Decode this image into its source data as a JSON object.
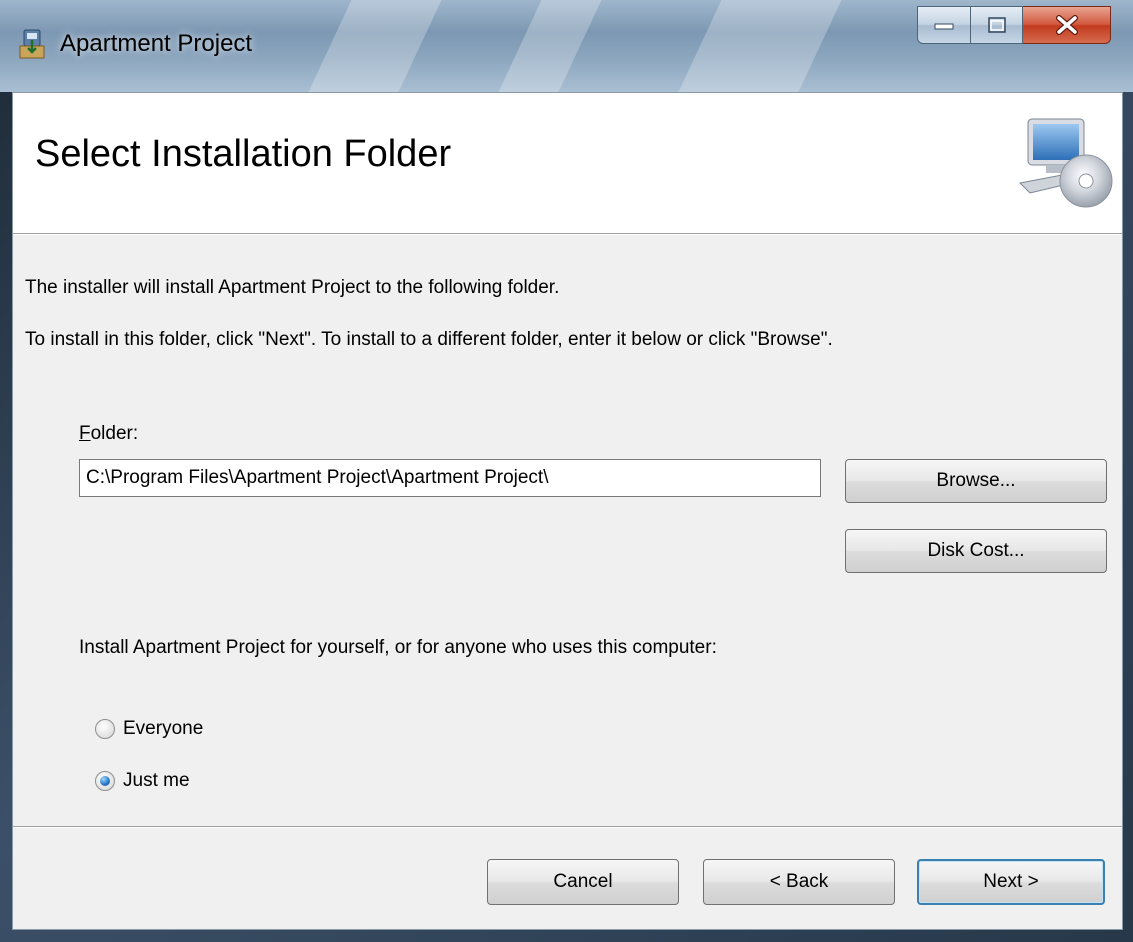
{
  "window": {
    "title": "Apartment Project",
    "caption_buttons": {
      "minimize": "minimize-icon",
      "maximize": "maximize-icon",
      "close": "close-icon"
    }
  },
  "banner": {
    "title": "Select Installation Folder",
    "icon": "computer-cd-icon"
  },
  "body": {
    "intro": "The installer will install Apartment Project to the following folder.",
    "instructions": "To install in this folder, click \"Next\". To install to a different folder, enter it below or click \"Browse\".",
    "folder_label_mnemonic": "F",
    "folder_label_rest": "older:",
    "folder_value": "C:\\Program Files\\Apartment Project\\Apartment Project\\",
    "browse_label": "Browse...",
    "disk_cost_label": "Disk Cost...",
    "scope_prompt": "Install Apartment Project for yourself, or for anyone who uses this computer:",
    "options": [
      {
        "label": "Everyone",
        "selected": false
      },
      {
        "label": "Just me",
        "selected": true
      }
    ]
  },
  "footer": {
    "cancel_label": "Cancel",
    "back_label": "< Back",
    "next_label": "Next >"
  },
  "colors": {
    "default_button_border": "#3c7fb1",
    "close_button": "#c33b1e",
    "dialog_background": "#f0f0f0"
  }
}
